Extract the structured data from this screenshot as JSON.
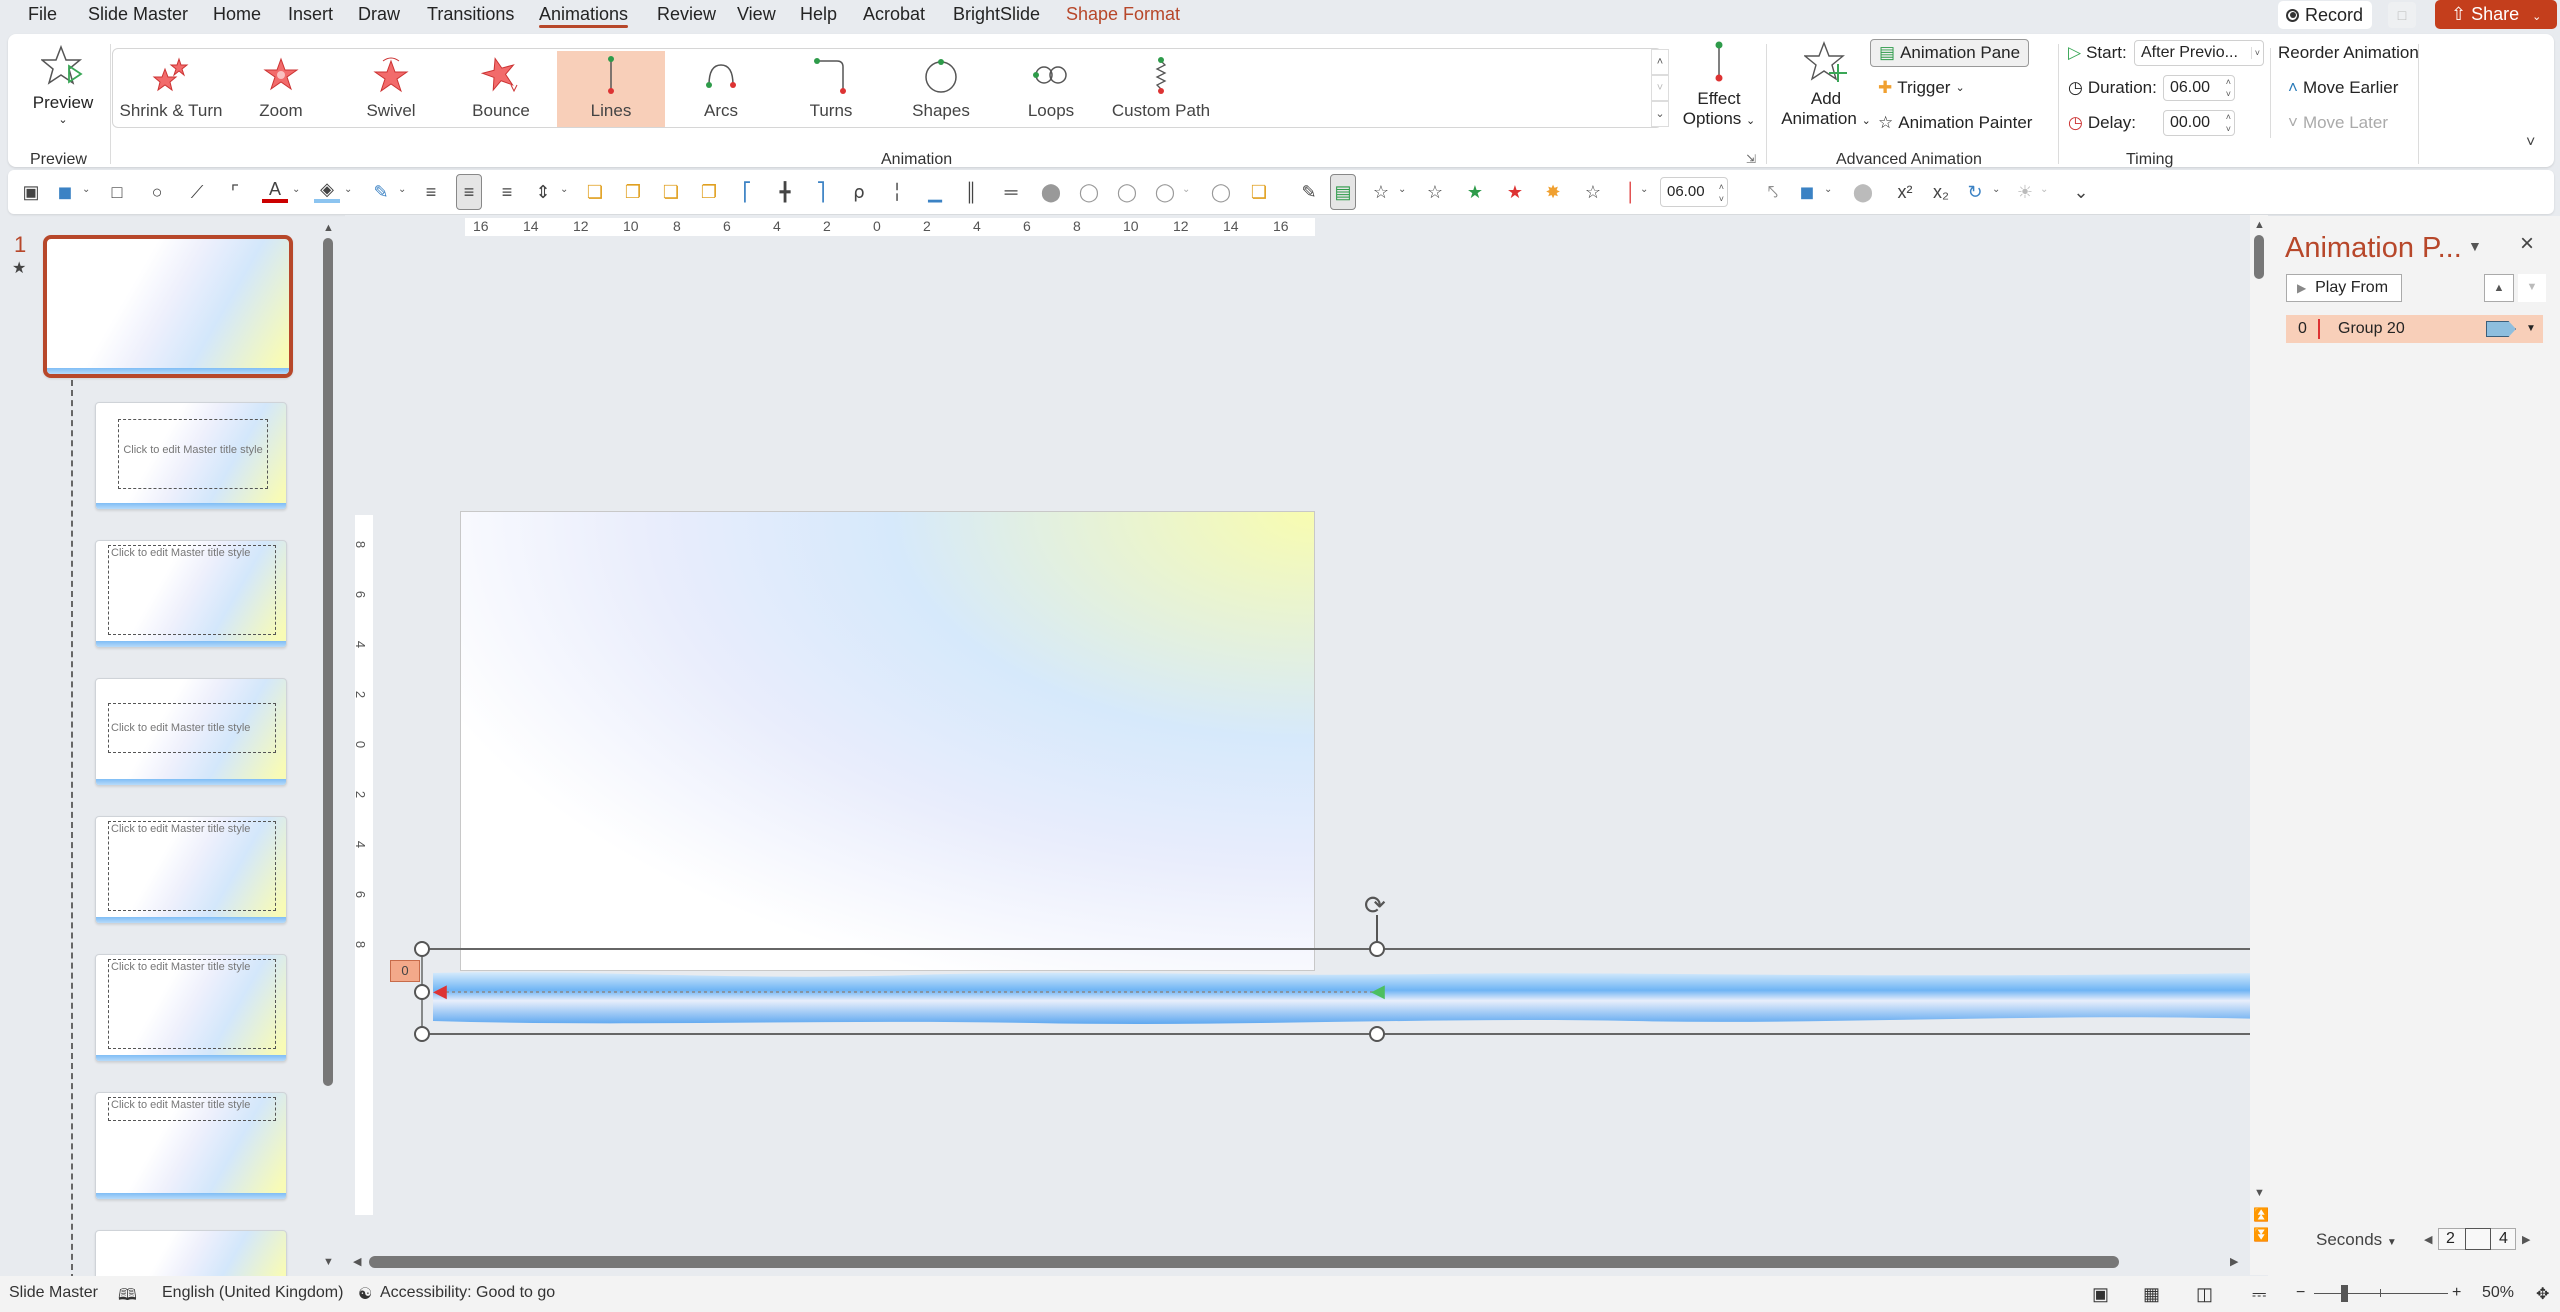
{
  "menu": {
    "tabs": [
      {
        "label": "File"
      },
      {
        "label": "Slide Master"
      },
      {
        "label": "Home"
      },
      {
        "label": "Insert"
      },
      {
        "label": "Draw"
      },
      {
        "label": "Transitions"
      },
      {
        "label": "Animations",
        "active": true
      },
      {
        "label": "Review"
      },
      {
        "label": "View"
      },
      {
        "label": "Help"
      },
      {
        "label": "Acrobat"
      },
      {
        "label": "BrightSlide"
      },
      {
        "label": "Shape Format",
        "contextual": true
      }
    ],
    "record_label": "Record",
    "share_label": "Share"
  },
  "ribbon": {
    "preview": {
      "label": "Preview",
      "group_label": "Preview"
    },
    "animation_gallery": {
      "group_label": "Animation",
      "items": [
        {
          "label": "Shrink & Turn",
          "icon": "shrink-turn-icon"
        },
        {
          "label": "Zoom",
          "icon": "zoom-star-icon"
        },
        {
          "label": "Swivel",
          "icon": "swivel-star-icon"
        },
        {
          "label": "Bounce",
          "icon": "bounce-star-icon"
        },
        {
          "label": "Lines",
          "icon": "line-path-icon",
          "selected": true
        },
        {
          "label": "Arcs",
          "icon": "arc-path-icon"
        },
        {
          "label": "Turns",
          "icon": "turn-path-icon"
        },
        {
          "label": "Shapes",
          "icon": "shape-path-icon"
        },
        {
          "label": "Loops",
          "icon": "loop-path-icon"
        },
        {
          "label": "Custom Path",
          "icon": "custom-path-icon"
        }
      ]
    },
    "effect_options": {
      "line1": "Effect",
      "line2": "Options"
    },
    "advanced": {
      "group_label": "Advanced Animation",
      "add_animation_line1": "Add",
      "add_animation_line2": "Animation",
      "animation_pane": "Animation Pane",
      "trigger": "Trigger",
      "animation_painter": "Animation Painter"
    },
    "timing": {
      "group_label": "Timing",
      "start_label": "Start:",
      "start_value": "After Previo...",
      "duration_label": "Duration:",
      "duration_value": "06.00",
      "delay_label": "Delay:",
      "delay_value": "00.00"
    },
    "reorder": {
      "title": "Reorder Animation",
      "move_earlier": "Move Earlier",
      "move_later": "Move Later"
    }
  },
  "drawbar": {
    "spin_value": "06.00"
  },
  "ruler": {
    "h_ticks": [
      "16",
      "14",
      "12",
      "10",
      "8",
      "6",
      "4",
      "2",
      "0",
      "2",
      "4",
      "6",
      "8",
      "10",
      "12",
      "14",
      "16"
    ],
    "v_ticks": [
      "8",
      "6",
      "4",
      "2",
      "0",
      "2",
      "4",
      "6",
      "8"
    ]
  },
  "thumbnails": {
    "master_number": "1",
    "layout_title": "Click to edit Master title style"
  },
  "canvas": {
    "animation_tag": "0"
  },
  "animation_pane": {
    "title": "Animation P...",
    "play_from": "Play From",
    "items": [
      {
        "number": "0",
        "name": "Group 20"
      }
    ],
    "timeline_unit": "Seconds",
    "timeline_ticks": [
      "2",
      "4"
    ]
  },
  "status": {
    "view": "Slide Master",
    "language": "English (United Kingdom)",
    "accessibility": "Accessibility: Good to go",
    "zoom": "50%"
  },
  "colors": {
    "accent": "#b7472a",
    "share": "#c43e1c",
    "selection": "#f8cfb9"
  }
}
